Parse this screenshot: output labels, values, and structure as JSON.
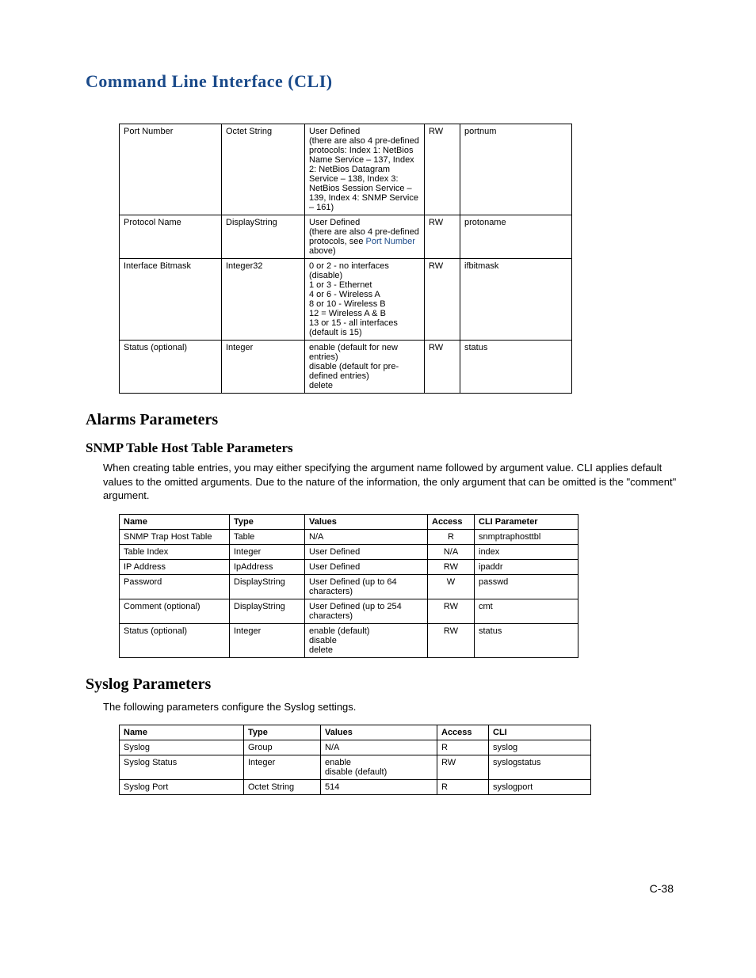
{
  "header": {
    "title": "Command Line Interface (CLI)"
  },
  "table1": {
    "rows": [
      {
        "name": "Port Number",
        "type": "Octet String",
        "values_lines": [
          "User Defined",
          "(there are also 4 pre-defined protocols: Index 1: NetBios Name Service – 137, Index 2: NetBios Datagram Service – 138, Index 3: NetBios Session Service – 139, Index 4: SNMP Service – 161)"
        ],
        "access": "RW",
        "cli": "portnum"
      },
      {
        "name": "Protocol Name",
        "type": "DisplayString",
        "values_lines": [
          "User Defined",
          "(there are also 4 pre-defined protocols, see "
        ],
        "values_link": "Port Number",
        "values_after_link": " above)",
        "access": "RW",
        "cli": "protoname"
      },
      {
        "name": "Interface Bitmask",
        "type": "Integer32",
        "values_lines": [
          "0 or 2 - no interfaces (disable)",
          "1 or 3 - Ethernet",
          "4 or 6 - Wireless A",
          "8 or 10 - Wireless B",
          "12 = Wireless A & B",
          "13 or 15 - all interfaces",
          "(default is 15)"
        ],
        "access": "RW",
        "cli": "ifbitmask"
      },
      {
        "name": "Status (optional)",
        "type": "Integer",
        "values_lines": [
          "enable (default for new entries)",
          "disable (default for pre-defined entries)",
          "delete"
        ],
        "access": "RW",
        "cli": "status"
      }
    ]
  },
  "alarms": {
    "heading": "Alarms Parameters",
    "snmp_heading": "SNMP Table Host Table Parameters",
    "snmp_text": "When creating table entries, you may either specifying the argument name followed by argument value. CLI applies default values to the omitted arguments. Due to the nature of the information, the only argument that can be omitted is the \"comment\" argument."
  },
  "table2": {
    "headers": {
      "name": "Name",
      "type": "Type",
      "values": "Values",
      "access": "Access",
      "cli": "CLI Parameter"
    },
    "rows": [
      {
        "name": "SNMP Trap Host Table",
        "type": "Table",
        "values": "N/A",
        "access": "R",
        "cli": "snmptraphosttbl"
      },
      {
        "name": "Table Index",
        "type": "Integer",
        "values": "User Defined",
        "access": "N/A",
        "cli": "index"
      },
      {
        "name": "IP Address",
        "type": "IpAddress",
        "values": "User Defined",
        "access": "RW",
        "cli": "ipaddr"
      },
      {
        "name": "Password",
        "type": "DisplayString",
        "values": "User Defined (up to 64 characters)",
        "access": "W",
        "cli": "passwd"
      },
      {
        "name": "Comment (optional)",
        "type": "DisplayString",
        "values": "User Defined (up to 254 characters)",
        "access": "RW",
        "cli": "cmt"
      },
      {
        "name": "Status (optional)",
        "type": "Integer",
        "values_lines": [
          "enable (default)",
          "disable",
          "delete"
        ],
        "access": "RW",
        "cli": "status"
      }
    ]
  },
  "syslog": {
    "heading": "Syslog Parameters",
    "text": "The following parameters configure the Syslog settings."
  },
  "table3": {
    "headers": {
      "name": "Name",
      "type": "Type",
      "values": "Values",
      "access": "Access",
      "cli": "CLI"
    },
    "rows": [
      {
        "name": "Syslog",
        "type": "Group",
        "values": "N/A",
        "access": "R",
        "cli": "syslog"
      },
      {
        "name": "Syslog Status",
        "type": "Integer",
        "values_lines": [
          "enable",
          "disable (default)"
        ],
        "access": "RW",
        "cli": "syslogstatus"
      },
      {
        "name": "Syslog Port",
        "type": "Octet String",
        "values": "514",
        "access": "R",
        "cli": "syslogport"
      }
    ]
  },
  "page_number": "C-38"
}
